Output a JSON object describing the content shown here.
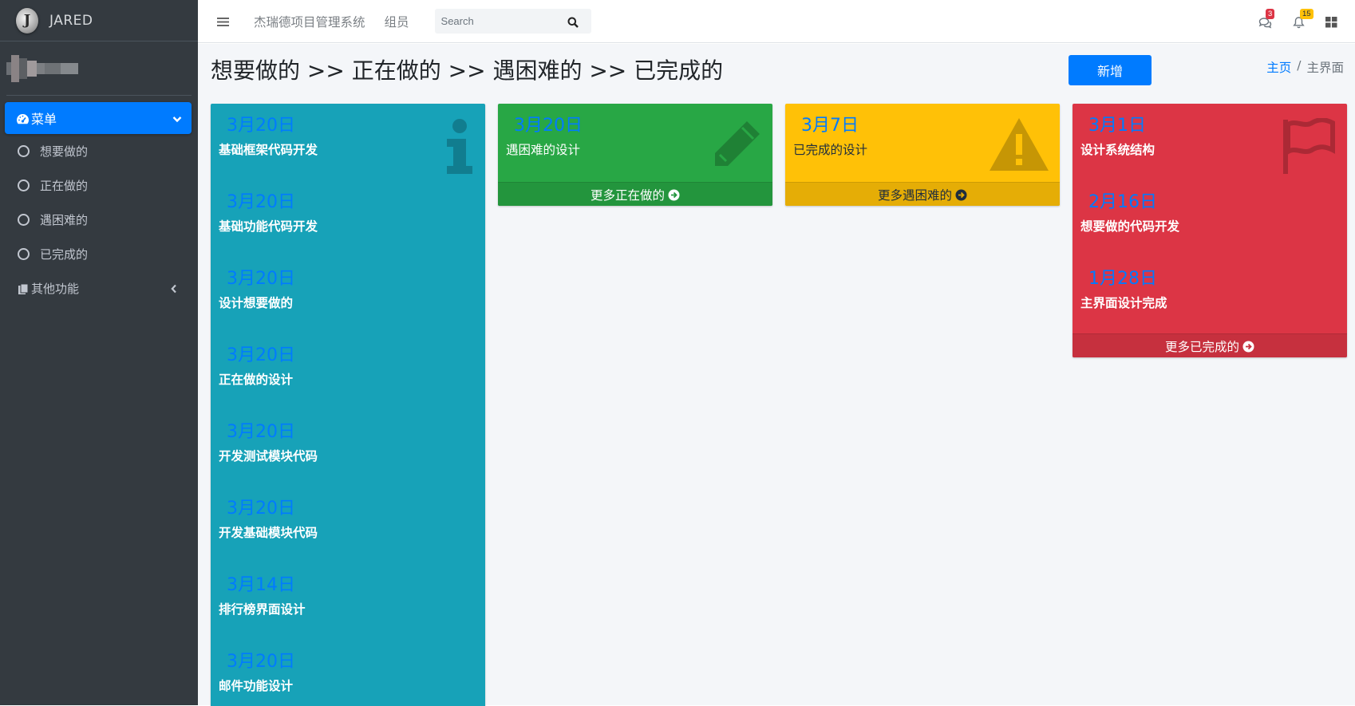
{
  "brand": {
    "logo_letter": "J",
    "name": "JARED"
  },
  "sidebar": {
    "menu_label": "菜单",
    "items": [
      {
        "label": "想要做的"
      },
      {
        "label": "正在做的"
      },
      {
        "label": "遇困难的"
      },
      {
        "label": "已完成的"
      }
    ],
    "other_label": "其他功能"
  },
  "topbar": {
    "links": [
      "杰瑞德项目管理系统",
      "组员"
    ],
    "search_placeholder": "Search",
    "messages_count": "3",
    "notifications_count": "15"
  },
  "page": {
    "title": "想要做的 >> 正在做的 >> 遇困难的 >> 已完成的",
    "add_button": "新增",
    "breadcrumb_home": "主页",
    "breadcrumb_sep": "/",
    "breadcrumb_current": "主界面"
  },
  "columns": {
    "todo": {
      "entries": [
        {
          "date": "3月20日",
          "title": "基础框架代码开发"
        },
        {
          "date": "3月20日",
          "title": "基础功能代码开发"
        },
        {
          "date": "3月20日",
          "title": "设计想要做的"
        },
        {
          "date": "3月20日",
          "title": "正在做的设计"
        },
        {
          "date": "3月20日",
          "title": "开发测试模块代码"
        },
        {
          "date": "3月20日",
          "title": "开发基础模块代码"
        },
        {
          "date": "3月14日",
          "title": "排行榜界面设计"
        },
        {
          "date": "3月20日",
          "title": "邮件功能设计"
        }
      ]
    },
    "doing": {
      "entries": [
        {
          "date": "3月20日",
          "title": "遇困难的设计"
        }
      ],
      "footer": "更多正在做的"
    },
    "stuck": {
      "entries": [
        {
          "date": "3月7日",
          "title": "已完成的设计"
        }
      ],
      "footer": "更多遇困难的"
    },
    "done": {
      "entries": [
        {
          "date": "3月1日",
          "title": "设计系统结构"
        },
        {
          "date": "2月16日",
          "title": "想要做的代码开发"
        },
        {
          "date": "1月28日",
          "title": "主界面设计完成"
        }
      ],
      "footer": "更多已完成的"
    }
  },
  "colors": {
    "primary": "#007bff",
    "info": "#17a2b8",
    "success": "#28a745",
    "warning": "#ffc107",
    "danger": "#dc3545",
    "sidebar": "#343a40"
  },
  "icons": {
    "todo": "info-icon",
    "doing": "pencil-icon",
    "stuck": "warning-icon",
    "done": "flag-icon"
  }
}
